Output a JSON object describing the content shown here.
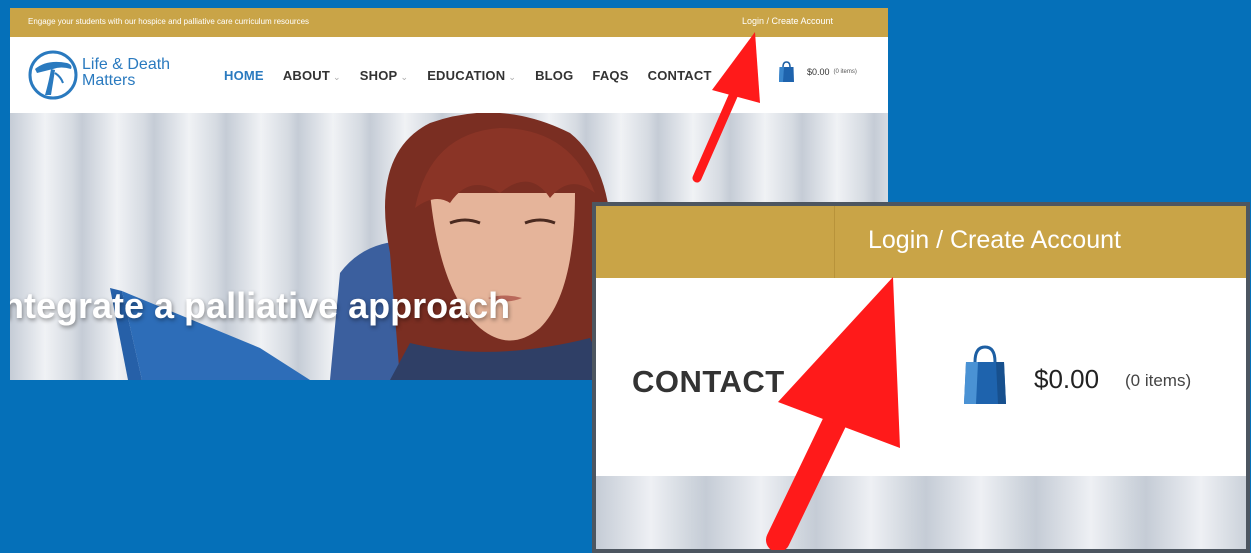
{
  "topbar": {
    "tagline": "Engage your students with our hospice and palliative care curriculum resources",
    "login_label": "Login / Create Account"
  },
  "brand": {
    "line1": "Life & Death",
    "line2": "Matters"
  },
  "nav": {
    "items": [
      {
        "label": "HOME",
        "active": true,
        "dropdown": false
      },
      {
        "label": "ABOUT",
        "active": false,
        "dropdown": true
      },
      {
        "label": "SHOP",
        "active": false,
        "dropdown": true
      },
      {
        "label": "EDUCATION",
        "active": false,
        "dropdown": true
      },
      {
        "label": "BLOG",
        "active": false,
        "dropdown": false
      },
      {
        "label": "FAQS",
        "active": false,
        "dropdown": false
      },
      {
        "label": "CONTACT",
        "active": false,
        "dropdown": false
      }
    ]
  },
  "cart": {
    "price": "$0.00",
    "count": "(0 items)",
    "icon": "shopping-bag-icon"
  },
  "hero": {
    "headline": "ntegrate a palliative approach"
  },
  "zoom": {
    "login_label": "Login / Create Account",
    "contact_label": "CONTACT",
    "price": "$0.00",
    "count": "(0 items)"
  },
  "colors": {
    "background": "#0570b9",
    "topbar": "#c9a447",
    "brand_blue": "#2a7abf",
    "arrow": "#ff1a1a",
    "zoom_border": "#4d5660"
  }
}
